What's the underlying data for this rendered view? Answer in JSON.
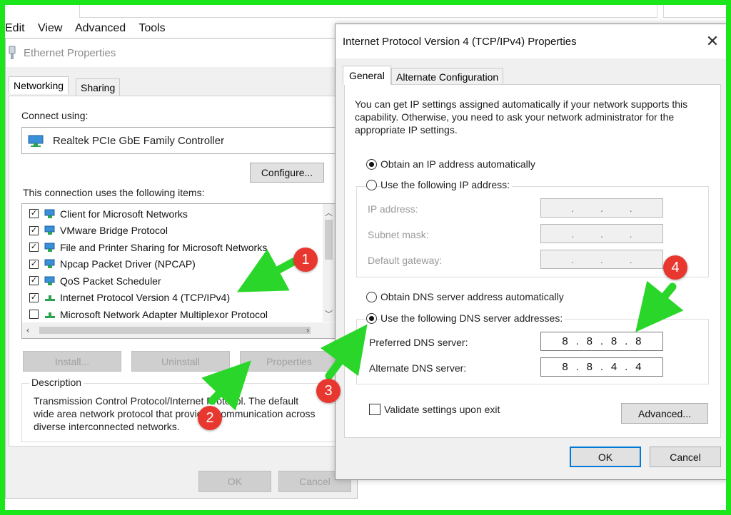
{
  "menubar": {
    "items": [
      "Edit",
      "View",
      "Advanced",
      "Tools"
    ]
  },
  "ethernet": {
    "title": "Ethernet Properties",
    "tabs": [
      "Networking",
      "Sharing"
    ],
    "connect_using_label": "Connect using:",
    "adapter_name": "Realtek PCIe GbE Family Controller",
    "configure_label": "Configure...",
    "items_label": "This connection uses the following items:",
    "items": [
      {
        "label": "Client for Microsoft Networks",
        "checked": true
      },
      {
        "label": "VMware Bridge Protocol",
        "checked": true
      },
      {
        "label": "File and Printer Sharing for Microsoft Networks",
        "checked": true
      },
      {
        "label": "Npcap Packet Driver (NPCAP)",
        "checked": true
      },
      {
        "label": "QoS Packet Scheduler",
        "checked": true
      },
      {
        "label": "Internet Protocol Version 4 (TCP/IPv4)",
        "checked": true
      },
      {
        "label": "Microsoft Network Adapter Multiplexor Protocol",
        "checked": false
      }
    ],
    "install_label": "Install...",
    "uninstall_label": "Uninstall",
    "properties_label": "Properties",
    "description_heading": "Description",
    "description_text": "Transmission Control Protocol/Internet Protocol. The default wide area network protocol that provides communication across diverse interconnected networks.",
    "ok_label": "OK",
    "cancel_label": "Cancel"
  },
  "ipv4": {
    "title": "Internet Protocol Version 4 (TCP/IPv4) Properties",
    "close_glyph": "✕",
    "tabs": [
      "General",
      "Alternate Configuration"
    ],
    "intro": "You can get IP settings assigned automatically if your network supports this capability. Otherwise, you need to ask your network administrator for the appropriate IP settings.",
    "obtain_ip_auto": "Obtain an IP address automatically",
    "use_following_ip": "Use the following IP address:",
    "ip_address_label": "IP address:",
    "subnet_mask_label": "Subnet mask:",
    "default_gateway_label": "Default gateway:",
    "obtain_dns_auto": "Obtain DNS server address automatically",
    "use_following_dns": "Use the following DNS server addresses:",
    "preferred_dns_label": "Preferred DNS server:",
    "alternate_dns_label": "Alternate DNS server:",
    "preferred_dns_value": [
      "8",
      "8",
      "8",
      "8"
    ],
    "alternate_dns_value": [
      "8",
      "8",
      "4",
      "4"
    ],
    "validate_label": "Validate settings upon exit",
    "advanced_label": "Advanced...",
    "ok_label": "OK",
    "cancel_label": "Cancel"
  },
  "annotations": {
    "badges": [
      "1",
      "2",
      "3",
      "4"
    ],
    "color": "#e8372f",
    "arrow_color": "#2ad62a"
  },
  "colors": {
    "frame": "#1be61b",
    "accent": "#0078d7"
  }
}
